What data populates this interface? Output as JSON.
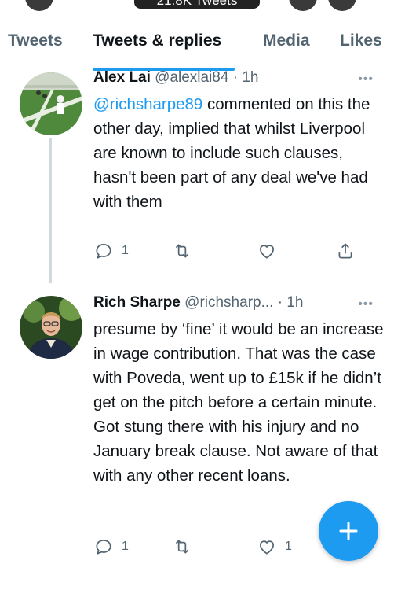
{
  "header": {
    "tweet_count": "21.8K Tweets"
  },
  "tabs": [
    {
      "label": "Tweets"
    },
    {
      "label": "Tweets & replies"
    },
    {
      "label": "Media"
    },
    {
      "label": "Likes"
    }
  ],
  "tweets": [
    {
      "name": "Alex Lai",
      "handle": "@alexlai84",
      "separator": " · ",
      "time": "1h",
      "mention": "@richsharpe89",
      "text": " commented on this the other day, implied that whilst Liverpool are known to include such clauses, hasn't been part of any deal we've had with them",
      "reply_count": "1",
      "like_count": ""
    },
    {
      "name": "Rich Sharpe",
      "handle": "@richsharp...",
      "separator": " · ",
      "time": "1h",
      "text": "presume by ‘fine’ it would be an increase in wage contribution. That was the case with Poveda, went up to £15k if he didn’t get on the pitch before a certain minute. Got stung there with his injury and no January break clause. Not aware of that with any other recent loans.",
      "reply_count": "1",
      "like_count": "1"
    }
  ],
  "colors": {
    "accent": "#1d9bf0",
    "muted": "#536471",
    "text": "#0f1419"
  }
}
